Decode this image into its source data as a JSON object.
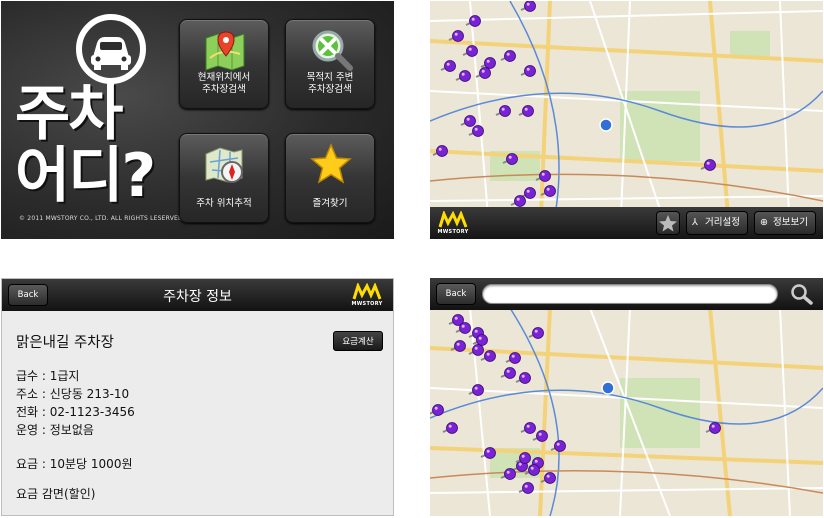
{
  "menu": {
    "title_line1": "주차",
    "title_line2": "어디?",
    "copyright": "© 2011 MWSTORY CO., LTD. ALL RIGHTS LESERVED.",
    "buttons": [
      {
        "label": "현재위치에서\n주차장검색",
        "icon": "map-pin-icon"
      },
      {
        "label": "목적지 주변\n주차장검색",
        "icon": "search-x-icon"
      },
      {
        "label": "주차 위치추적",
        "icon": "map-compass-icon"
      },
      {
        "label": "즐겨찾기",
        "icon": "star-icon"
      }
    ]
  },
  "map_view": {
    "logo": "MWSTORY",
    "buttons": {
      "favorite_icon": "star-icon",
      "distance": "거리설정",
      "info": "정보보기"
    }
  },
  "info": {
    "back": "Back",
    "title": "주차장 정보",
    "logo": "MWSTORY",
    "lot_name": "맑은내길 주차장",
    "fee_button": "요금계산",
    "grade": "급수 : 1급지",
    "address": "주소 : 신당동 213-10",
    "phone": "전화 : 02-1123-3456",
    "operation": "운영 : 정보없음",
    "fee": "요금 : 10분당 1000원",
    "discount": "요금 감면(할인)"
  },
  "search_map": {
    "back": "Back",
    "search_value": "",
    "search_icon": "magnifier-icon"
  },
  "colors": {
    "pin": "#7a22d6",
    "current_location": "#2f6fd6",
    "toolbar": "#1b1b1b"
  }
}
